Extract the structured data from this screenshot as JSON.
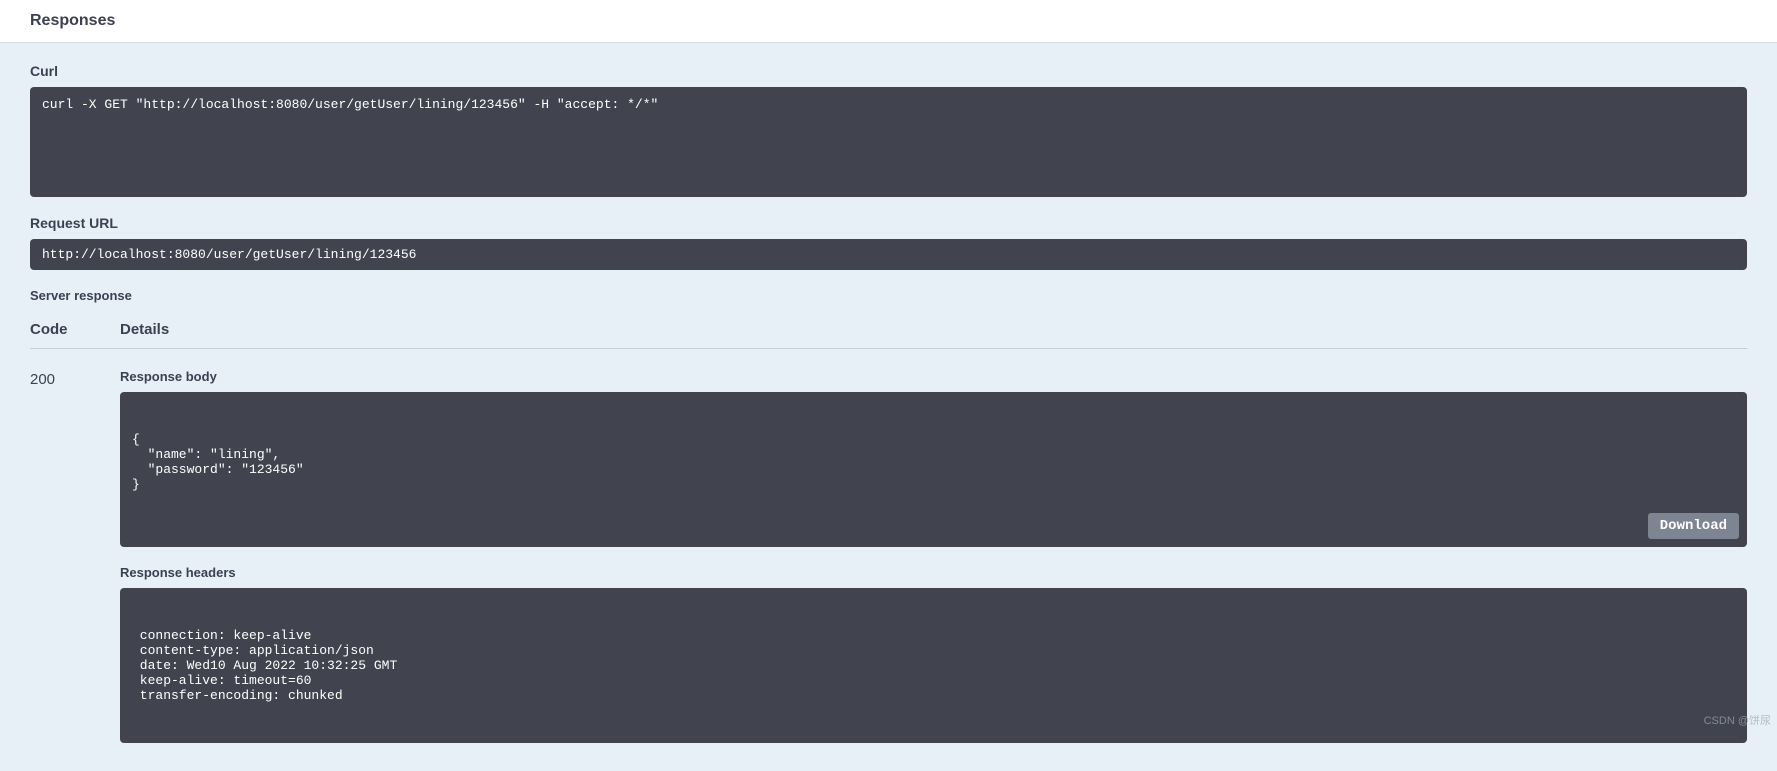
{
  "header": {
    "title": "Responses"
  },
  "curl": {
    "label": "Curl",
    "command": "curl -X GET \"http://localhost:8080/user/getUser/lining/123456\" -H \"accept: */*\""
  },
  "requestUrl": {
    "label": "Request URL",
    "url": "http://localhost:8080/user/getUser/lining/123456"
  },
  "serverResponse": {
    "label": "Server response",
    "columns": {
      "code": "Code",
      "details": "Details"
    },
    "rows": [
      {
        "code": "200",
        "responseBodyLabel": "Response body",
        "responseBody": "{\n  \"name\": \"lining\",\n  \"password\": \"123456\"\n}",
        "downloadLabel": "Download",
        "responseHeadersLabel": "Response headers",
        "responseHeaders": " connection: keep-alive\n content-type: application/json\n date: Wed10 Aug 2022 10:32:25 GMT\n keep-alive: timeout=60\n transfer-encoding: chunked"
      }
    ]
  },
  "watermark": "CSDN @饼尿"
}
